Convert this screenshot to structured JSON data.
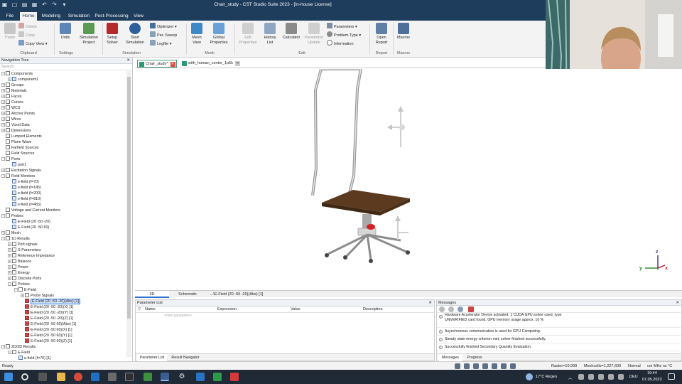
{
  "window": {
    "title": "Chair_study - CST Studio Suite 2023 - [In-house License]"
  },
  "menu": {
    "tabs": [
      "File",
      "Home",
      "Modeling",
      "Simulation",
      "Post-Processing",
      "View"
    ],
    "active": "Home"
  },
  "ribbon": {
    "clipboard": {
      "paste": "Paste",
      "delete": "Delete",
      "copy": "Copy",
      "copy_view": "Copy View",
      "label": "Clipboard"
    },
    "settings": {
      "units": "Units",
      "simulation_project": "Simulation Project",
      "label": "Settings"
    },
    "simulation": {
      "setup_solver": "Setup Solver",
      "start_simulation": "Start Simulation",
      "optimizer": "Optimizer",
      "par_sweep": "Par. Sweep",
      "logfile": "Logfile",
      "label": "Simulation"
    },
    "mesh": {
      "mesh_view": "Mesh View",
      "global_properties": "Global Properties",
      "label": "Mesh"
    },
    "edit": {
      "edit_properties": "Edit Properties",
      "history_list": "History List",
      "calculator": "Calculator",
      "parametric_update": "Parametric Update",
      "parameters": "Parameters",
      "problem_type": "Problem Type",
      "information": "Information",
      "label": "Edit"
    },
    "report": {
      "open_report": "Open Report",
      "label": "Report"
    },
    "macros": {
      "macros": "Macros",
      "label": "Macros"
    }
  },
  "nav": {
    "title": "Navigation Tree",
    "search_placeholder": "Search",
    "items": [
      {
        "label": "Components",
        "depth": 0,
        "expander": "-",
        "icon": "folder"
      },
      {
        "label": "component1",
        "depth": 1,
        "expander": "+",
        "icon": "component"
      },
      {
        "label": "Groups",
        "depth": 0,
        "expander": "+",
        "icon": "folder"
      },
      {
        "label": "Materials",
        "depth": 0,
        "expander": "+",
        "icon": "folder"
      },
      {
        "label": "Faces",
        "depth": 0,
        "expander": "+",
        "icon": "folder"
      },
      {
        "label": "Curves",
        "depth": 0,
        "expander": "+",
        "icon": "folder"
      },
      {
        "label": "WCS",
        "depth": 0,
        "expander": "+",
        "icon": "folder"
      },
      {
        "label": "Anchor Points",
        "depth": 0,
        "expander": "+",
        "icon": "folder"
      },
      {
        "label": "Wires",
        "depth": 0,
        "expander": "+",
        "icon": "folder"
      },
      {
        "label": "Voxel Data",
        "depth": 0,
        "expander": "+",
        "icon": "folder"
      },
      {
        "label": "Dimensions",
        "depth": 0,
        "expander": "+",
        "icon": "folder"
      },
      {
        "label": "Lumped Elements",
        "depth": 0,
        "expander": "",
        "icon": "folder"
      },
      {
        "label": "Plane Wave",
        "depth": 0,
        "expander": "",
        "icon": "folder"
      },
      {
        "label": "Farfield Sources",
        "depth": 0,
        "expander": "",
        "icon": "folder"
      },
      {
        "label": "Field Sources",
        "depth": 0,
        "expander": "",
        "icon": "folder"
      },
      {
        "label": "Ports",
        "depth": 0,
        "expander": "-",
        "icon": "folder"
      },
      {
        "label": "port1",
        "depth": 1,
        "expander": "",
        "icon": "port"
      },
      {
        "label": "Excitation Signals",
        "depth": 0,
        "expander": "+",
        "icon": "folder"
      },
      {
        "label": "Field Monitors",
        "depth": 0,
        "expander": "-",
        "icon": "folder"
      },
      {
        "label": "e-field (f=70)",
        "depth": 1,
        "expander": "",
        "icon": "monitor"
      },
      {
        "label": "e-field (f=145)",
        "depth": 1,
        "expander": "",
        "icon": "monitor"
      },
      {
        "label": "e-field (f=200)",
        "depth": 1,
        "expander": "",
        "icon": "monitor"
      },
      {
        "label": "e-field (f=810)",
        "depth": 1,
        "expander": "",
        "icon": "monitor"
      },
      {
        "label": "e-field (f=465)",
        "depth": 1,
        "expander": "",
        "icon": "monitor"
      },
      {
        "label": "Voltage and Current Monitors",
        "depth": 0,
        "expander": "",
        "icon": "folder"
      },
      {
        "label": "Probes",
        "depth": 0,
        "expander": "-",
        "icon": "folder"
      },
      {
        "label": "E-Field (20 -50 -20)",
        "depth": 1,
        "expander": "",
        "icon": "port"
      },
      {
        "label": "E-Field (20 -50 60)",
        "depth": 1,
        "expander": "",
        "icon": "port"
      },
      {
        "label": "Mesh",
        "depth": 0,
        "expander": "+",
        "icon": "folder"
      },
      {
        "label": "1D Results",
        "depth": 0,
        "expander": "-",
        "icon": "folder"
      },
      {
        "label": "Port signals",
        "depth": 1,
        "expander": "+",
        "icon": "folder"
      },
      {
        "label": "S-Parameters",
        "depth": 1,
        "expander": "+",
        "icon": "folder"
      },
      {
        "label": "Reference Impedance",
        "depth": 1,
        "expander": "+",
        "icon": "folder"
      },
      {
        "label": "Balance",
        "depth": 1,
        "expander": "+",
        "icon": "folder"
      },
      {
        "label": "Power",
        "depth": 1,
        "expander": "+",
        "icon": "folder"
      },
      {
        "label": "Energy",
        "depth": 1,
        "expander": "+",
        "icon": "folder"
      },
      {
        "label": "Discrete Ports",
        "depth": 1,
        "expander": "+",
        "icon": "folder"
      },
      {
        "label": "Probes",
        "depth": 1,
        "expander": "-",
        "icon": "folder"
      },
      {
        "label": "E-Field",
        "depth": 2,
        "expander": "-",
        "icon": "folder"
      },
      {
        "label": "Probe Signals",
        "depth": 3,
        "expander": "+",
        "icon": "folder"
      },
      {
        "label": "E-Field (20 -50 -20)(Abs) [1]",
        "depth": 3,
        "expander": "",
        "icon": "probe",
        "selected": true
      },
      {
        "label": "E-Field (20 -50 -20)(X) [1]",
        "depth": 3,
        "expander": "",
        "icon": "probe"
      },
      {
        "label": "E-Field (20 -50 -20)(Y) [1]",
        "depth": 3,
        "expander": "",
        "icon": "probe"
      },
      {
        "label": "E-Field (20 -50 -20)(Z) [1]",
        "depth": 3,
        "expander": "",
        "icon": "probe"
      },
      {
        "label": "E-Field (20 -50 60)(Abs) [1]",
        "depth": 3,
        "expander": "",
        "icon": "probe"
      },
      {
        "label": "E-Field (20 -50 60)(X) [1]",
        "depth": 3,
        "expander": "",
        "icon": "probe"
      },
      {
        "label": "E-Field (20 -50 60)(Y) [1]",
        "depth": 3,
        "expander": "",
        "icon": "probe"
      },
      {
        "label": "E-Field (20 -50 60)(Z) [1]",
        "depth": 3,
        "expander": "",
        "icon": "probe"
      },
      {
        "label": "2D/3D Results",
        "depth": 0,
        "expander": "-",
        "icon": "folder"
      },
      {
        "label": "E-Field",
        "depth": 1,
        "expander": "-",
        "icon": "folder"
      },
      {
        "label": "e-field (f=70) [1]",
        "depth": 2,
        "expander": "",
        "icon": "monitor"
      }
    ]
  },
  "doc_tabs": [
    {
      "label": "Chair_study*",
      "active": true
    },
    {
      "label": "with_human_center_1p5k",
      "active": false
    }
  ],
  "view_tabs": [
    {
      "label": "3D",
      "active": true
    },
    {
      "label": "Schematic",
      "active": false
    },
    {
      "label": "...\\E-Field (20 -50 -20)(Abs) [1]",
      "active": false
    }
  ],
  "axes": {
    "x": "x",
    "y": "y",
    "z": "z"
  },
  "param_list": {
    "title": "Parameter List",
    "columns": [
      "Name",
      "Expression",
      "Value",
      "Description"
    ],
    "new_param": "<new parameter>",
    "tabs": [
      "Parameter List",
      "Result Navigator"
    ]
  },
  "messages": {
    "title": "Messages",
    "items": [
      "Hardware Accelerator Device activated: 1 CUDA GPU solver used, type UNVERIFIED card found, GPU memory usage approx. 10 %",
      "Asynchronous communication is used for GPU Computing.",
      "Steady state energy criterion met, solver finished successfully.",
      "Successfully finished Secondary Quantity Evaluation."
    ],
    "tabs": [
      "Messages",
      "Progress"
    ]
  },
  "status": {
    "left": "Ready",
    "raster": "Raster=10.000",
    "meshcells": "Meshcells=1,227,600",
    "mode": "Normal",
    "units": "cm  MHz  ns  °C"
  },
  "taskbar": {
    "weather": "17°C  Regen",
    "lang": "DEU",
    "time": "19:44",
    "date": "07.05.2023"
  }
}
